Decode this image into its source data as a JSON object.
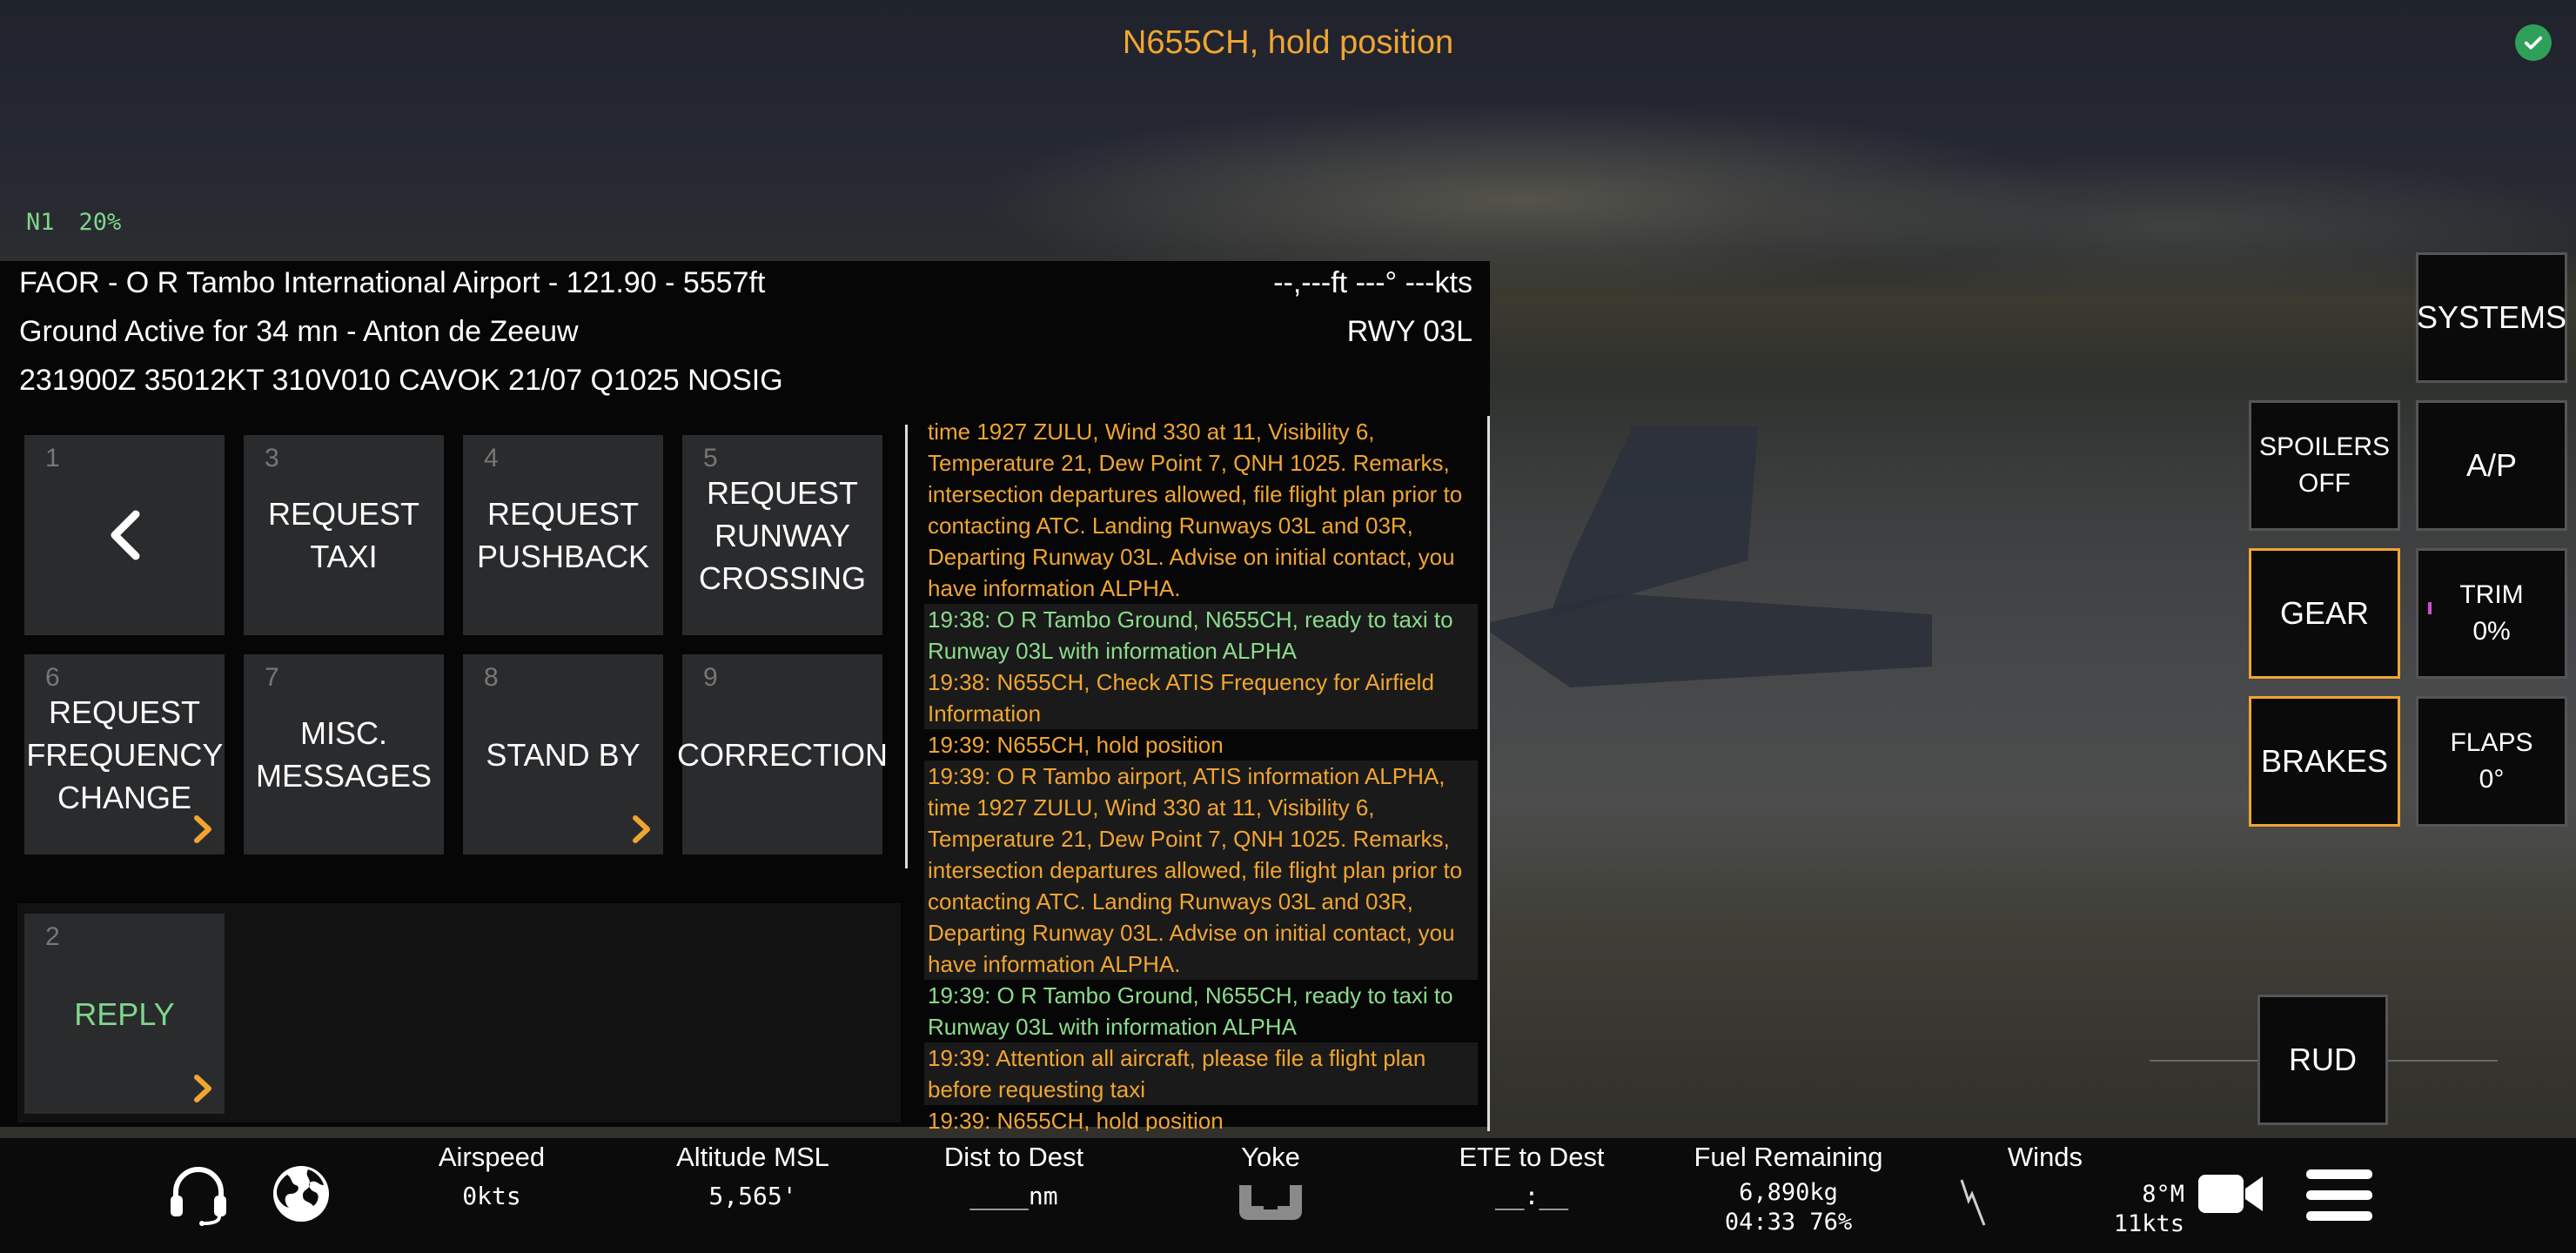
{
  "banner": "N655CH, hold position",
  "engine": {
    "label": "N1",
    "value": "20%"
  },
  "header": {
    "airport": "FAOR - O R Tambo International Airport - 121.90 - 5557ft",
    "controller": "Ground Active for 34 mn - Anton de Zeeuw",
    "metar": "231900Z 35012KT 310V010 CAVOK 21/07 Q1025 NOSIG",
    "readout": "--,---ft  ---° ---kts",
    "runway": "RWY 03L"
  },
  "atc_menu": [
    {
      "num": "1",
      "label": "",
      "icon": "chevron-left-icon"
    },
    {
      "num": "3",
      "label": "REQUEST TAXI"
    },
    {
      "num": "4",
      "label": "REQUEST PUSHBACK"
    },
    {
      "num": "5",
      "label": "REQUEST RUNWAY CROSSING"
    },
    {
      "num": "6",
      "label": "REQUEST FREQUENCY CHANGE",
      "submenu": true
    },
    {
      "num": "7",
      "label": "MISC. MESSAGES"
    },
    {
      "num": "8",
      "label": "STAND BY",
      "submenu": true
    },
    {
      "num": "9",
      "label": "CORRECTION"
    }
  ],
  "reply": {
    "num": "2",
    "label": "REPLY"
  },
  "log": [
    {
      "text": "time 1927 ZULU, Wind 330 at 11, Visibility 6, Temperature 21, Dew Point 7, QNH 1025. Remarks, intersection departures allowed, file flight plan prior to contacting ATC. Landing Runways 03L and 03R, Departing Runway 03L. Advise on initial contact, you have information ALPHA.",
      "color": "orange"
    },
    {
      "text": "19:38: O R Tambo  Ground, N655CH, ready to taxi to Runway 03L with information ALPHA",
      "color": "green"
    },
    {
      "text": "19:38: N655CH, Check ATIS Frequency for Airfield Information",
      "color": "orange"
    },
    {
      "text": "19:39: N655CH, hold position",
      "color": "orange"
    },
    {
      "text": "19:39: O R Tambo  airport, ATIS information ALPHA, time 1927 ZULU, Wind 330 at 11, Visibility 6, Temperature 21, Dew Point 7, QNH 1025. Remarks, intersection departures allowed, file flight plan prior to contacting ATC. Landing Runways 03L and 03R, Departing Runway 03L. Advise on initial contact, you have information ALPHA.",
      "color": "orange"
    },
    {
      "text": "19:39: O R Tambo  Ground, N655CH, ready to taxi to Runway 03L with information ALPHA",
      "color": "green"
    },
    {
      "text": "19:39: Attention all aircraft, please file a flight plan before requesting taxi",
      "color": "orange"
    },
    {
      "text": "19:39: N655CH, hold position",
      "color": "orange"
    }
  ],
  "controls": {
    "systems": "SYSTEMS",
    "spoilers": "SPOILERS\nOFF",
    "autopilot": "A/P",
    "gear": "GEAR",
    "trim": "TRIM\n0%",
    "brakes": "BRAKES",
    "flaps": "FLAPS\n0°",
    "rudder": "RUD"
  },
  "status_bar": {
    "airspeed": {
      "title": "Airspeed",
      "value": "0kts"
    },
    "altitude": {
      "title": "Altitude MSL",
      "value": "5,565'"
    },
    "dist": {
      "title": "Dist to Dest",
      "value": "____nm"
    },
    "yoke": {
      "title": "Yoke"
    },
    "ete": {
      "title": "ETE to Dest",
      "value": "__:__"
    },
    "fuel": {
      "title": "Fuel Remaining",
      "line1": "6,890kg",
      "line2": "04:33 76%"
    },
    "winds": {
      "title": "Winds",
      "line1": "8°M",
      "line2": "11kts"
    }
  },
  "colors": {
    "accent": "#f0a531",
    "green": "#7fd68b",
    "ok": "#2fa05a"
  }
}
